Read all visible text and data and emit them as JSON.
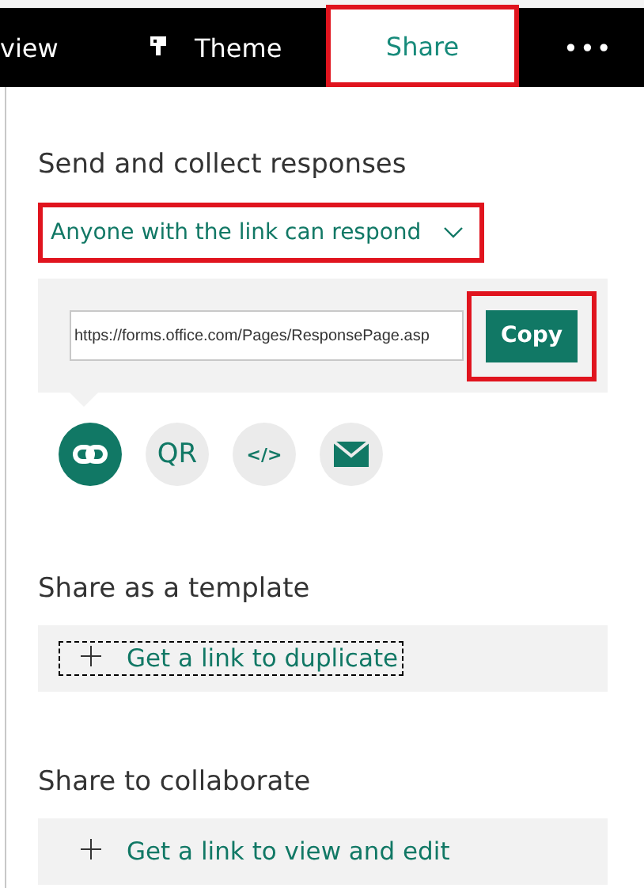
{
  "tabs": [
    {
      "label": "view",
      "selected": false,
      "highlighted": false
    },
    {
      "label": "Theme",
      "selected": false,
      "highlighted": false
    },
    {
      "label": "Share",
      "selected": true,
      "highlighted": true
    }
  ],
  "more": "•••",
  "send": {
    "heading": "Send and collect responses",
    "permission": {
      "label": "Anyone with the link can respond",
      "highlighted": true
    },
    "url": "https://forms.office.com/Pages/ResponsePage.asp",
    "copy": {
      "label": "Copy",
      "highlighted": true
    },
    "methods": [
      {
        "kind": "link",
        "selected": true
      },
      {
        "kind": "text",
        "label": "QR",
        "selected": false
      },
      {
        "kind": "text",
        "label": "</>",
        "selected": false
      },
      {
        "kind": "mail",
        "selected": false
      }
    ]
  },
  "sections": [
    {
      "heading": "Share as a template",
      "action": "Get a link to duplicate",
      "focused": true
    },
    {
      "heading": "Share to collaborate",
      "action": "Get a link to view and edit",
      "focused": false
    }
  ]
}
